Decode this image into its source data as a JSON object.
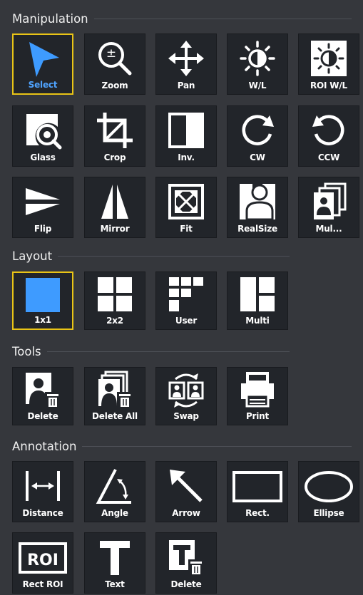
{
  "colors": {
    "background": "#35373c",
    "button": "#22252a",
    "selected_border": "#e9c416",
    "accent_blue": "#3e9bff"
  },
  "sections": {
    "manipulation": "Manipulation",
    "layout": "Layout",
    "tools": "Tools",
    "annotation": "Annotation"
  },
  "manipulation": [
    {
      "label": "Select",
      "icon": "arrow-pointer-icon",
      "selected": true
    },
    {
      "label": "Zoom",
      "icon": "zoom-icon"
    },
    {
      "label": "Pan",
      "icon": "pan-icon"
    },
    {
      "label": "W/L",
      "icon": "window-level-icon"
    },
    {
      "label": "ROI W/L",
      "icon": "roi-window-level-icon"
    },
    {
      "label": "Glass",
      "icon": "magnifier-glass-icon"
    },
    {
      "label": "Crop",
      "icon": "crop-icon"
    },
    {
      "label": "Inv.",
      "icon": "invert-icon"
    },
    {
      "label": "CW",
      "icon": "rotate-cw-icon"
    },
    {
      "label": "CCW",
      "icon": "rotate-ccw-icon"
    },
    {
      "label": "Flip",
      "icon": "flip-icon"
    },
    {
      "label": "Mirror",
      "icon": "mirror-icon"
    },
    {
      "label": "Fit",
      "icon": "fit-icon"
    },
    {
      "label": "RealSize",
      "icon": "real-size-icon"
    },
    {
      "label": "Mul...",
      "icon": "multi-image-icon"
    }
  ],
  "layout": [
    {
      "label": "1x1",
      "icon": "layout-1x1-icon",
      "selected": true
    },
    {
      "label": "2x2",
      "icon": "layout-2x2-icon"
    },
    {
      "label": "User",
      "icon": "layout-user-icon"
    },
    {
      "label": "Multi",
      "icon": "layout-multi-icon"
    }
  ],
  "tools": [
    {
      "label": "Delete",
      "icon": "delete-image-icon"
    },
    {
      "label": "Delete All",
      "icon": "delete-all-icon"
    },
    {
      "label": "Swap",
      "icon": "swap-icon"
    },
    {
      "label": "Print",
      "icon": "print-icon"
    }
  ],
  "annotation": [
    {
      "label": "Distance",
      "icon": "distance-icon"
    },
    {
      "label": "Angle",
      "icon": "angle-icon"
    },
    {
      "label": "Arrow",
      "icon": "arrow-icon"
    },
    {
      "label": "Rect.",
      "icon": "rectangle-icon"
    },
    {
      "label": "Ellipse",
      "icon": "ellipse-icon"
    },
    {
      "label": "Rect ROI",
      "icon": "rect-roi-icon"
    },
    {
      "label": "Text",
      "icon": "text-icon"
    },
    {
      "label": "Delete",
      "icon": "delete-annotation-icon"
    }
  ],
  "roi_text": "ROI"
}
